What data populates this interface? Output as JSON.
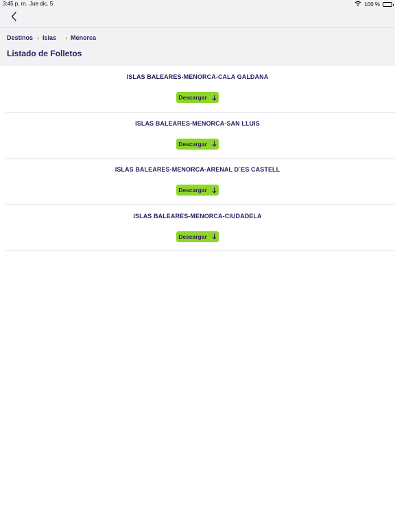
{
  "status_bar": {
    "time": "3:45 p. m.",
    "date": "Jue dic. 5",
    "battery": "100 %"
  },
  "breadcrumb": [
    "Destinos",
    "Islas",
    "Menorca"
  ],
  "page_title": "Listado de Folletos",
  "brochures": [
    {
      "title": "ISLAS BALEARES-MENORCA-CALA GALDANA",
      "button": "Descargar"
    },
    {
      "title": "ISLAS BALEARES-MENORCA-SAN LLUIS",
      "button": "Descargar"
    },
    {
      "title": "ISLAS BALEARES-MENORCA-ARENAL D`ES CASTELL",
      "button": "Descargar"
    },
    {
      "title": "ISLAS BALEARES-MENORCA-CIUDADELA",
      "button": "Descargar"
    }
  ],
  "icons": {
    "back": "chevron-left-icon",
    "wifi": "wifi-icon",
    "battery": "battery-icon",
    "breadcrumb_separator": "chevron-right-icon",
    "download": "arrow-down-icon"
  },
  "colors": {
    "primary_text": "#2d1a5c",
    "accent": "#8ed72a",
    "header_bg": "#f2f2f4"
  }
}
